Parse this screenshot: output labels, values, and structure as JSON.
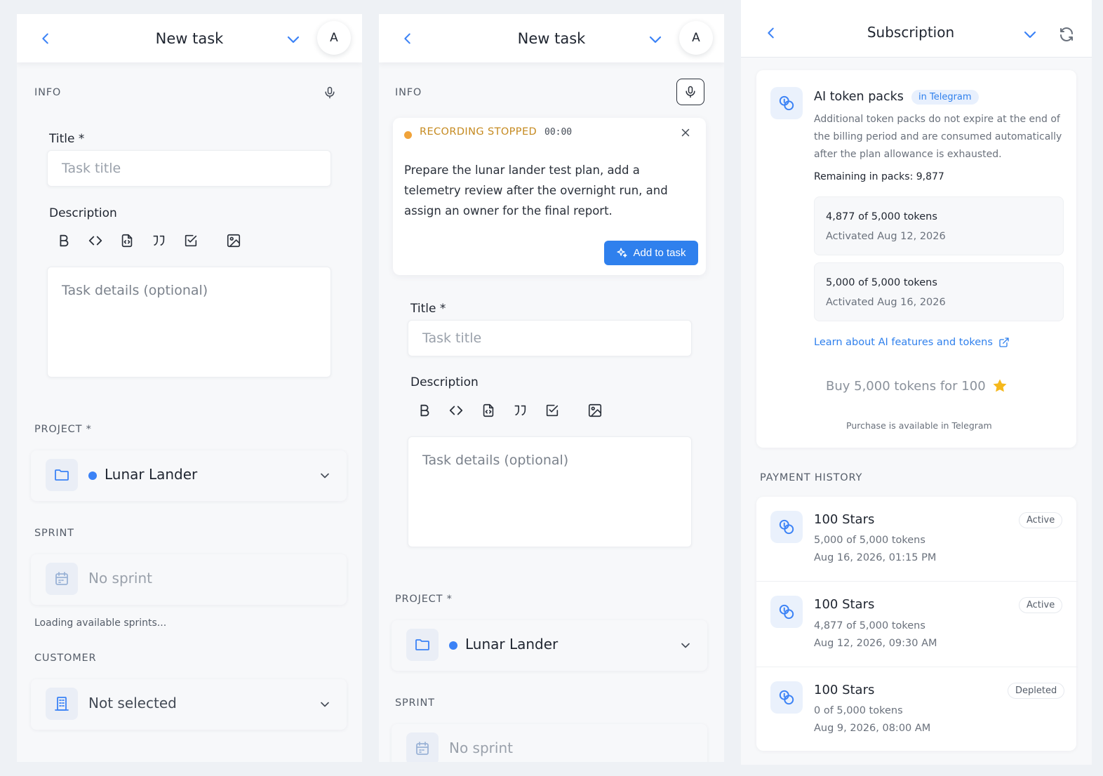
{
  "left_panel": {
    "header": {
      "title": "New task",
      "avatar": "A"
    },
    "info_label": "INFO",
    "title_label": "Title *",
    "title_placeholder": "Task title",
    "description_label": "Description",
    "details_placeholder": "Task details (optional)",
    "project_label": "PROJECT *",
    "project_value": "Lunar Lander",
    "sprint_label": "SPRINT",
    "sprint_value": "No sprint",
    "loading_text": "Loading available sprints...",
    "customer_label": "CUSTOMER",
    "customer_value": "Not selected"
  },
  "middle_panel": {
    "header": {
      "title": "New task",
      "avatar": "A"
    },
    "info_label": "INFO",
    "recording": {
      "status": "RECORDING STOPPED",
      "time": "00:00",
      "transcript": "Prepare the lunar lander test plan, add a telemetry review after the overnight run, and assign an owner for the final report.",
      "button_label": "Add to task"
    },
    "title_label": "Title *",
    "title_placeholder": "Task title",
    "description_label": "Description",
    "details_placeholder": "Task details (optional)",
    "project_label": "PROJECT *",
    "project_value": "Lunar Lander",
    "sprint_label": "SPRINT",
    "sprint_value": "No sprint"
  },
  "subscription": {
    "title": "Subscription",
    "token_packs": {
      "title": "AI token packs",
      "badge": "in Telegram",
      "description": "Additional token packs do not expire at the end of the billing period and are consumed automatically after the plan allowance is exhausted.",
      "remaining": "Remaining in packs: 9,877",
      "packs": [
        {
          "amount": "4,877 of 5,000 tokens",
          "activated": "Activated Aug 12, 2026"
        },
        {
          "amount": "5,000 of 5,000 tokens",
          "activated": "Activated Aug 16, 2026"
        }
      ],
      "learn_link": "Learn about AI features and tokens",
      "buy_label": "Buy 5,000 tokens for 100",
      "purchase_note": "Purchase is available in Telegram"
    },
    "payment_history_label": "PAYMENT HISTORY",
    "payments": [
      {
        "title": "100 Stars",
        "tokens": "5,000 of 5,000 tokens",
        "date": "Aug 16, 2026, 01:15 PM",
        "status": "Active"
      },
      {
        "title": "100 Stars",
        "tokens": "4,877 of 5,000 tokens",
        "date": "Aug 12, 2026, 09:30 AM",
        "status": "Active"
      },
      {
        "title": "100 Stars",
        "tokens": "0 of 5,000 tokens",
        "date": "Aug 9, 2026, 08:00 AM",
        "status": "Depleted"
      }
    ]
  },
  "colors": {
    "accent": "#2f80ed",
    "project_dot": "#3b82f6",
    "recording": "#f0a33a",
    "star": "#f5b81c"
  }
}
